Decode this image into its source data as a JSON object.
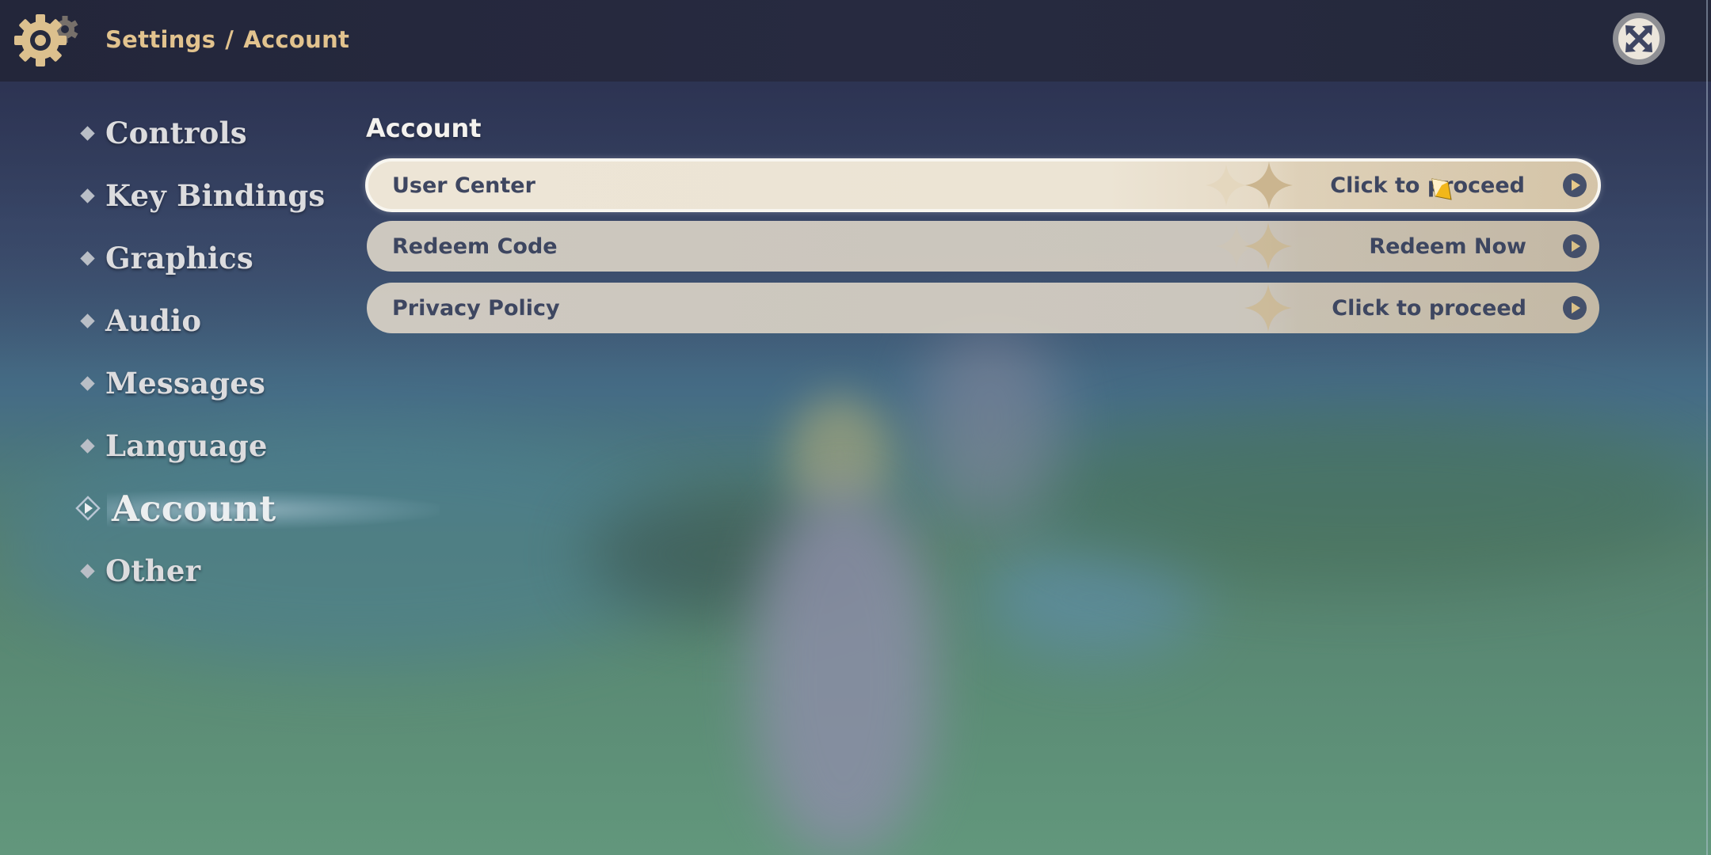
{
  "header": {
    "icon": "gear-icon",
    "breadcrumb": {
      "section": "Settings",
      "separator": "/",
      "page": "Account"
    },
    "close_icon": "close-icon"
  },
  "sidebar": {
    "items": [
      {
        "label": "Controls",
        "active": false
      },
      {
        "label": "Key Bindings",
        "active": false
      },
      {
        "label": "Graphics",
        "active": false
      },
      {
        "label": "Audio",
        "active": false
      },
      {
        "label": "Messages",
        "active": false
      },
      {
        "label": "Language",
        "active": false
      },
      {
        "label": "Account",
        "active": true
      },
      {
        "label": "Other",
        "active": false
      }
    ]
  },
  "main": {
    "title": "Account",
    "rows": [
      {
        "label": "User Center",
        "action": "Click to proceed",
        "selected": true
      },
      {
        "label": "Redeem Code",
        "action": "Redeem Now",
        "selected": false
      },
      {
        "label": "Privacy Policy",
        "action": "Click to proceed",
        "selected": false
      }
    ]
  },
  "colors": {
    "header_bg": "#24283b",
    "accent_gold": "#e2c38e",
    "row_text": "#3e4660",
    "arrow_bg": "#45506b",
    "arrow_fg": "#e6c98a"
  }
}
